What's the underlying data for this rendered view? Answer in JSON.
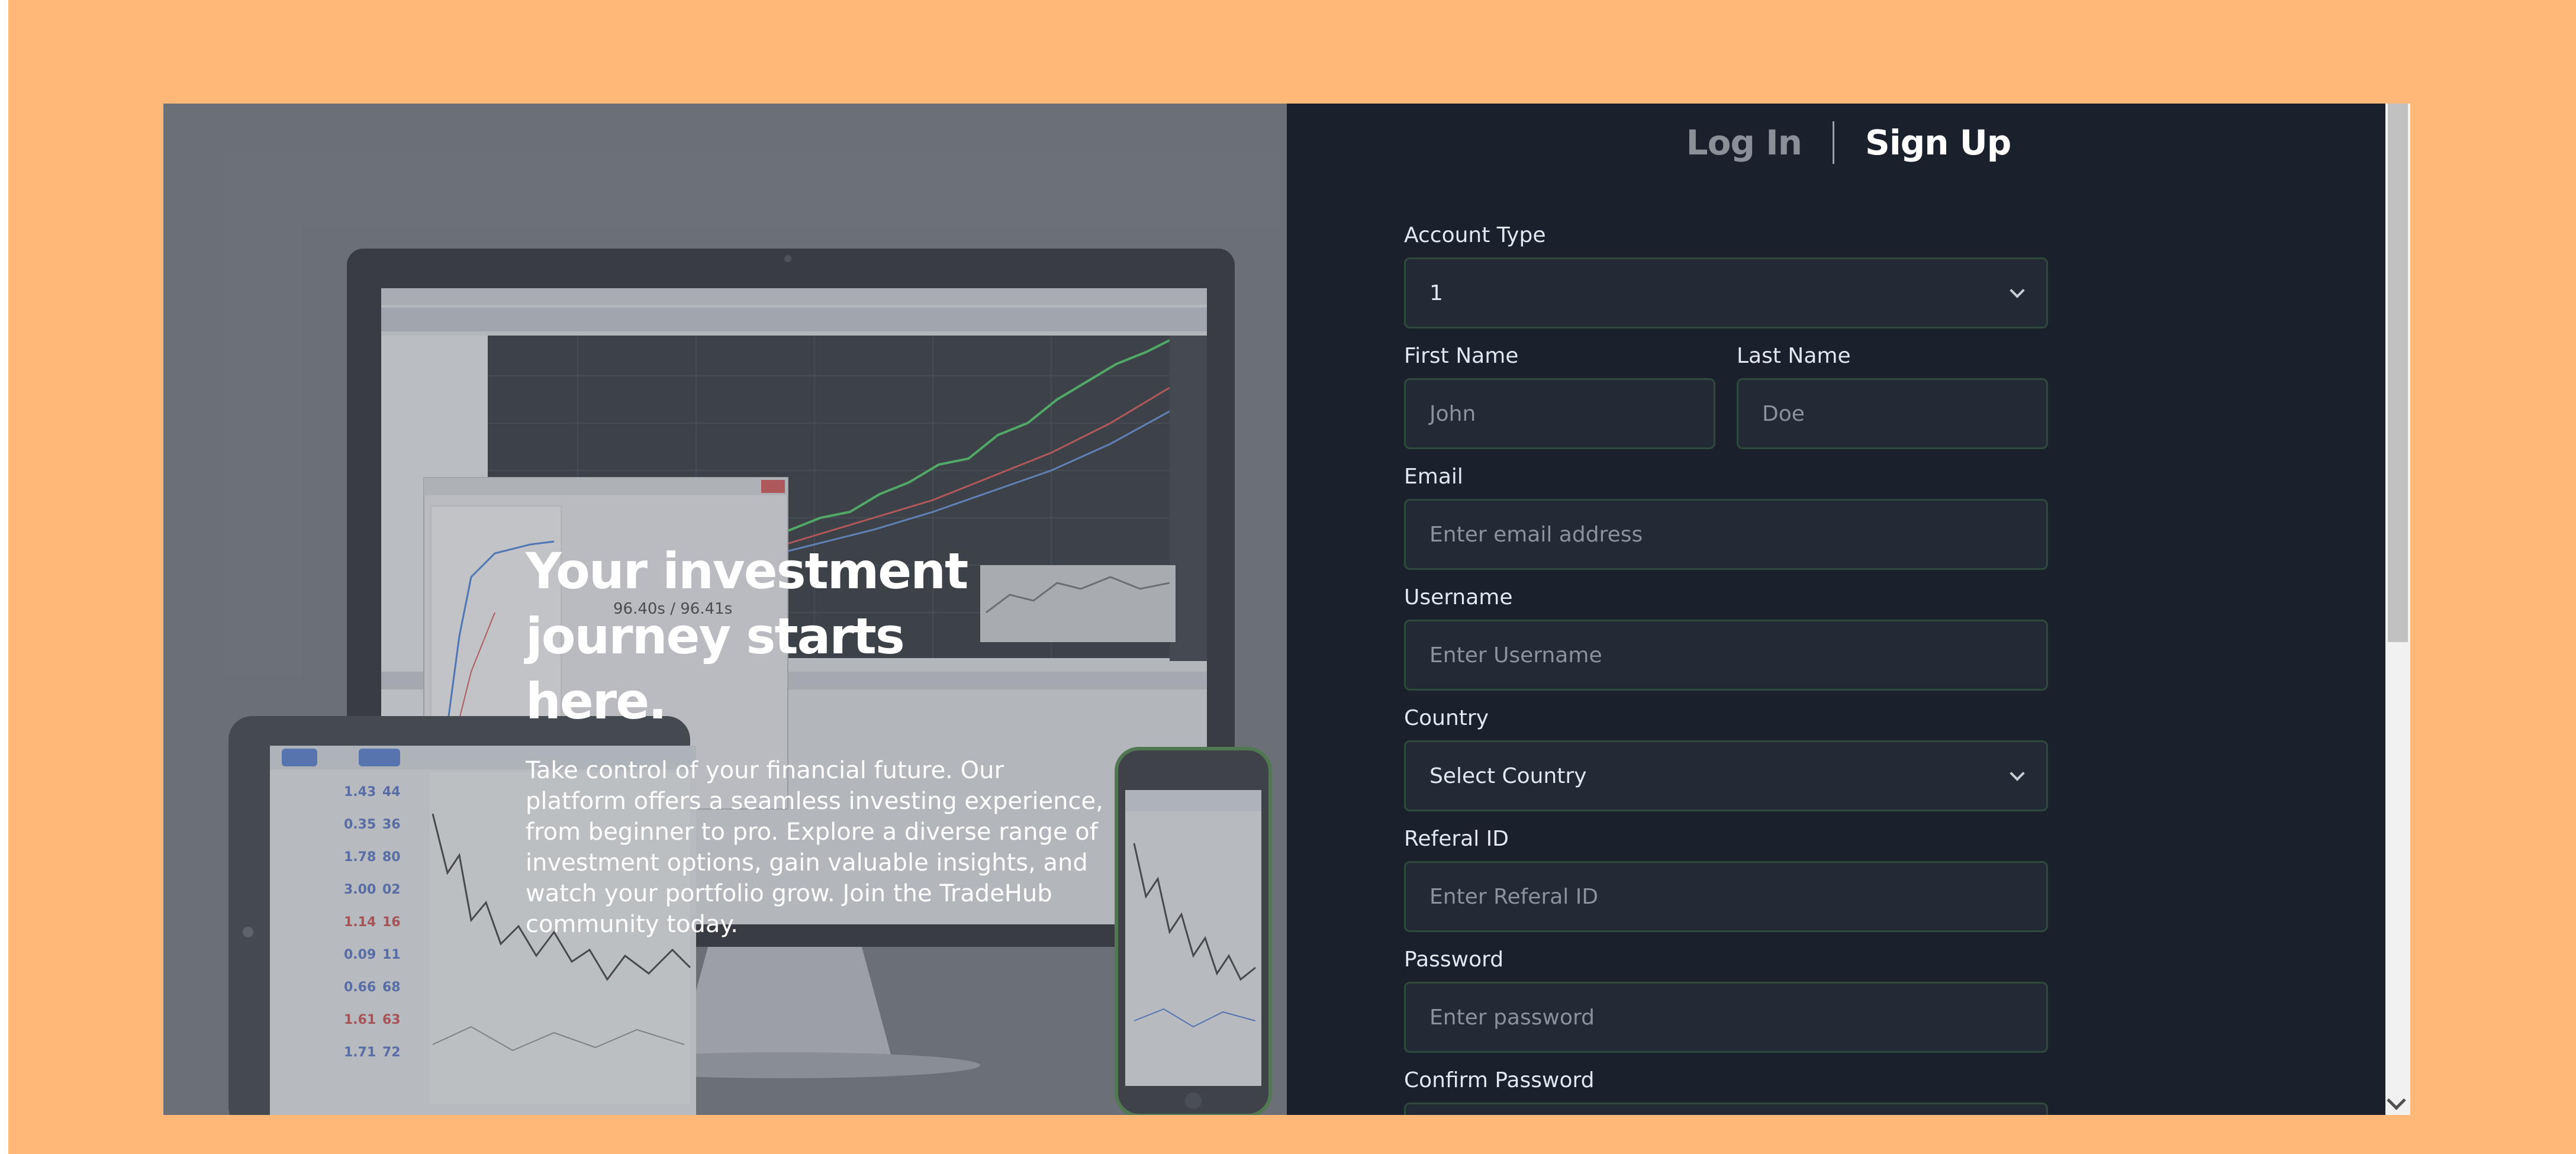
{
  "colors": {
    "page_background": "#FFB877",
    "panel_background": "#1a202c",
    "input_background": "#222a35",
    "input_border": "#2f4a3c",
    "hero_background": "#6c7078"
  },
  "hero": {
    "title": "Your investment journey starts here.",
    "description": "Take control of your financial future. Our platform offers a seamless investing experience, from beginner to pro. Explore a diverse range of investment options, gain valuable insights, and watch your portfolio grow. Join the TradeHub community today."
  },
  "tabs": {
    "login": "Log In",
    "signup": "Sign Up"
  },
  "form": {
    "account_type": {
      "label": "Account Type",
      "value": "1"
    },
    "first_name": {
      "label": "First Name",
      "placeholder": "John"
    },
    "last_name": {
      "label": "Last Name",
      "placeholder": "Doe"
    },
    "email": {
      "label": "Email",
      "placeholder": "Enter email address"
    },
    "username": {
      "label": "Username",
      "placeholder": "Enter Username"
    },
    "country": {
      "label": "Country",
      "value": "Select Country"
    },
    "referal": {
      "label": "Referal ID",
      "placeholder": "Enter Referal ID"
    },
    "password": {
      "label": "Password",
      "placeholder": "Enter password"
    },
    "confirm_password": {
      "label": "Confirm Password",
      "placeholder": ""
    }
  },
  "icons": {
    "select_chevron": "chevron-down-icon",
    "scroll_down": "scroll-down-arrow-icon"
  }
}
